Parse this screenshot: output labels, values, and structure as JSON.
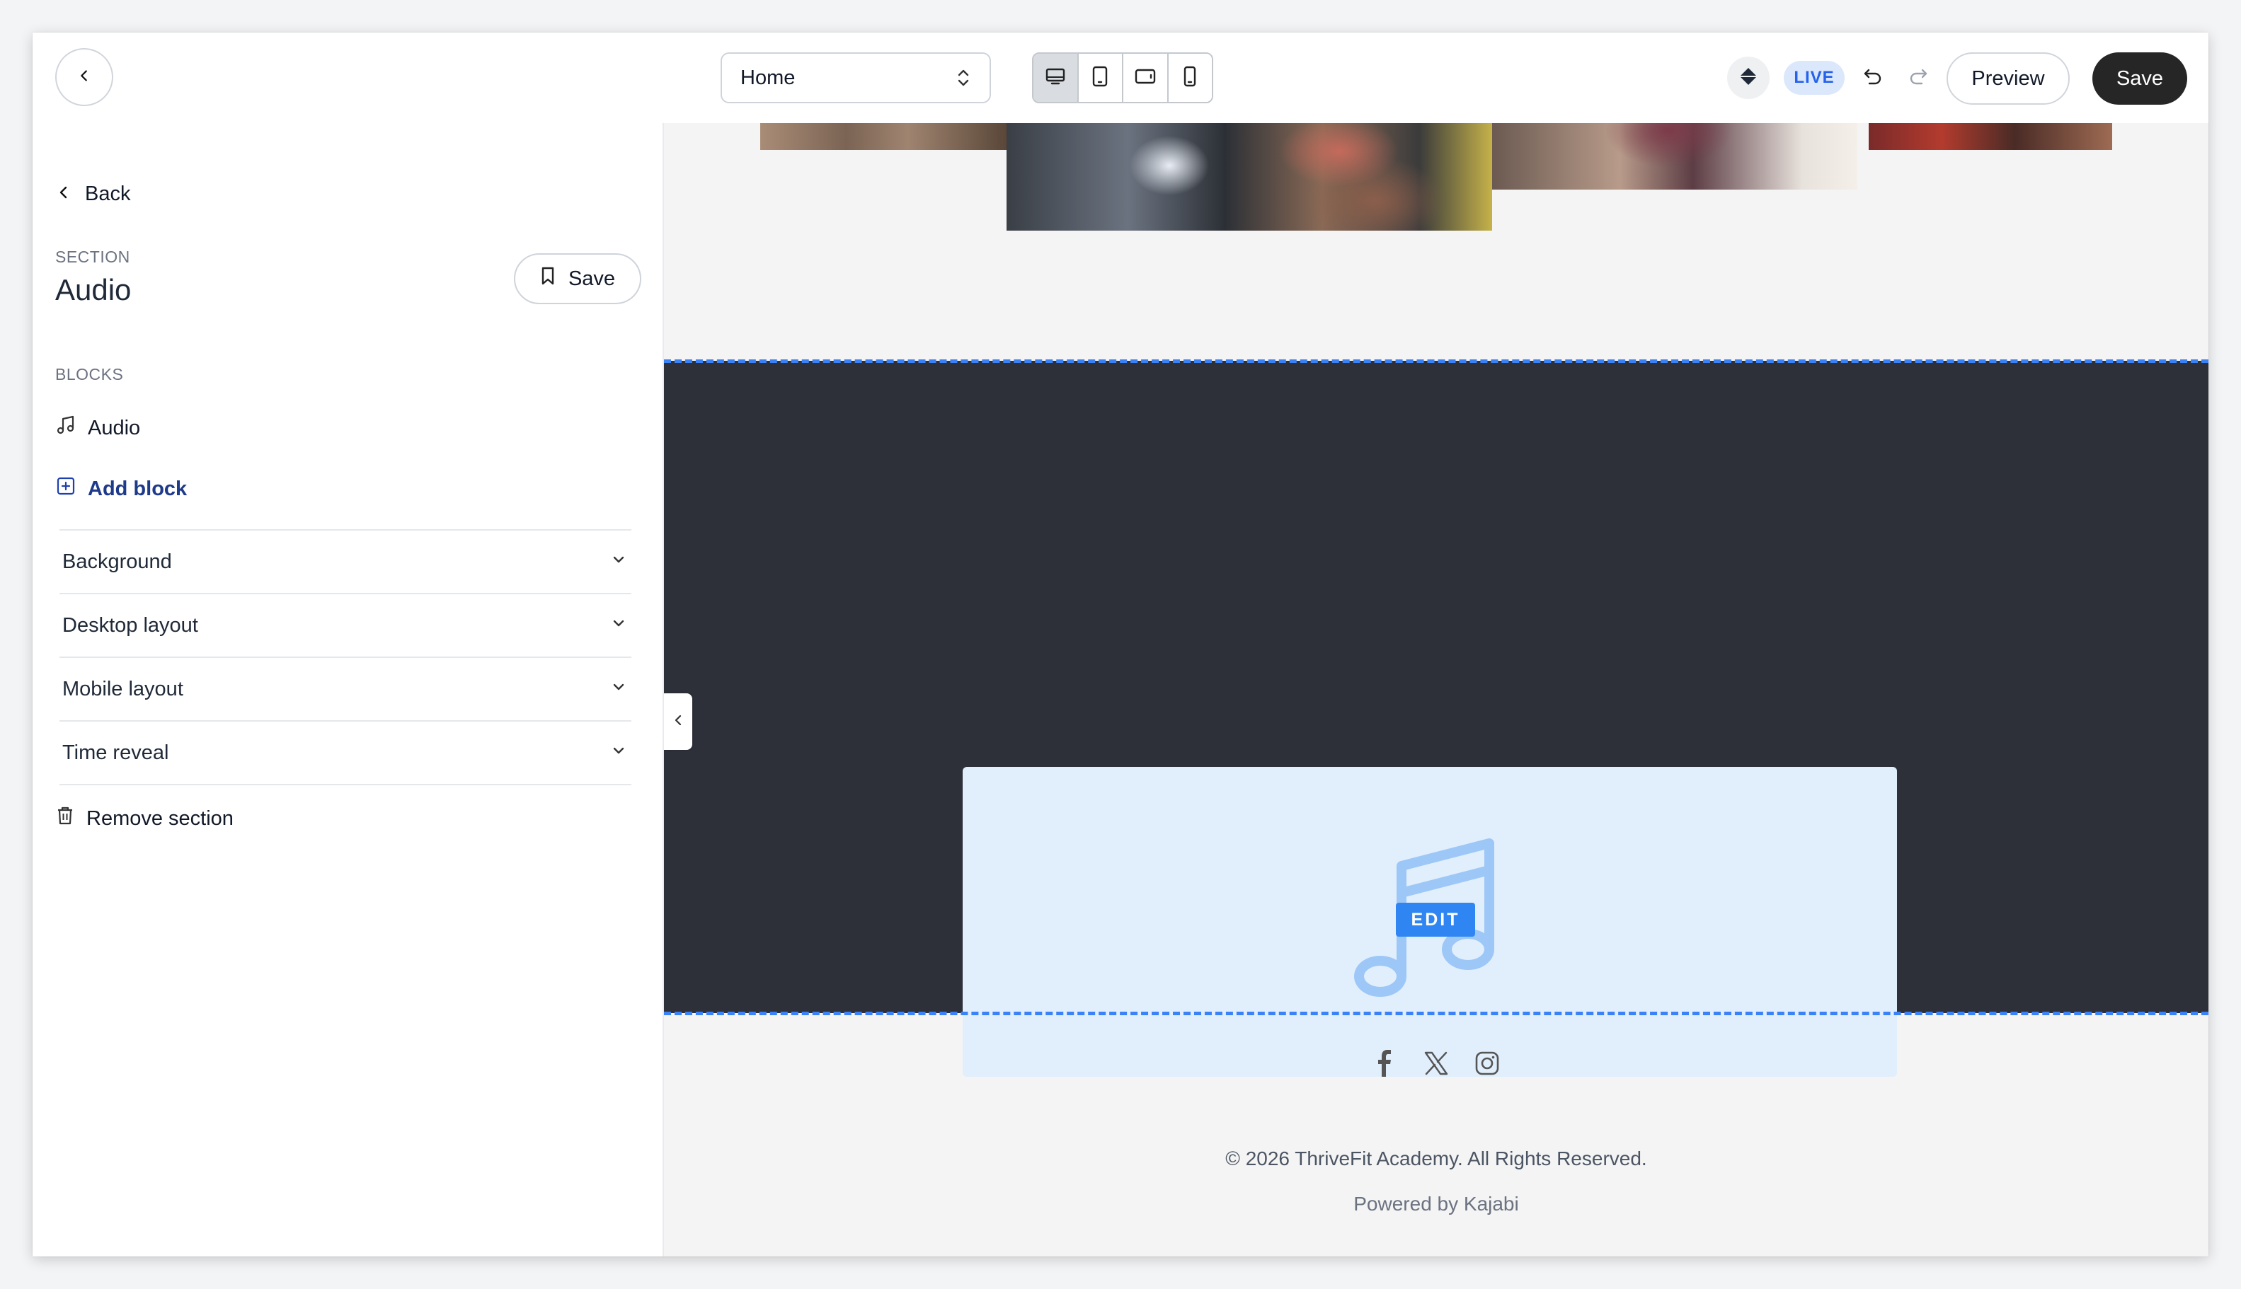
{
  "topbar": {
    "page_select": {
      "value": "Home"
    },
    "device_modes": [
      "desktop",
      "tablet-portrait",
      "tablet-landscape",
      "mobile"
    ],
    "active_device": "desktop",
    "status_badge": "LIVE",
    "preview_label": "Preview",
    "save_label": "Save",
    "icons": {
      "back": "chevron-left-icon",
      "diamond": "diamond-icon",
      "undo": "undo-icon",
      "redo": "redo-icon",
      "sort": "chevron-up-down-icon"
    }
  },
  "sidebar": {
    "back_label": "Back",
    "section_kicker": "SECTION",
    "section_title": "Audio",
    "save_section_label": "Save",
    "blocks_kicker": "BLOCKS",
    "blocks": [
      {
        "label": "Audio",
        "icon": "music-note-icon"
      }
    ],
    "add_block_label": "Add block",
    "accordion": [
      {
        "label": "Background"
      },
      {
        "label": "Desktop layout"
      },
      {
        "label": "Mobile layout"
      },
      {
        "label": "Time reveal"
      }
    ],
    "remove_section_label": "Remove section"
  },
  "canvas": {
    "audio_block": {
      "edit_label": "EDIT",
      "icon": "music-note-icon"
    },
    "footer": {
      "social_icons": [
        "facebook-icon",
        "x-icon",
        "instagram-icon"
      ],
      "copyright": "© 2026 ThriveFit Academy. All Rights Reserved.",
      "powered_by": "Powered by Kajabi"
    }
  },
  "colors": {
    "accent": "#2f86f2",
    "dark_section": "#2d3039",
    "audio_bg": "#e1eefc",
    "live_badge_bg": "#dbe7fb",
    "live_badge_text": "#2563eb",
    "save_button": "#262626"
  }
}
